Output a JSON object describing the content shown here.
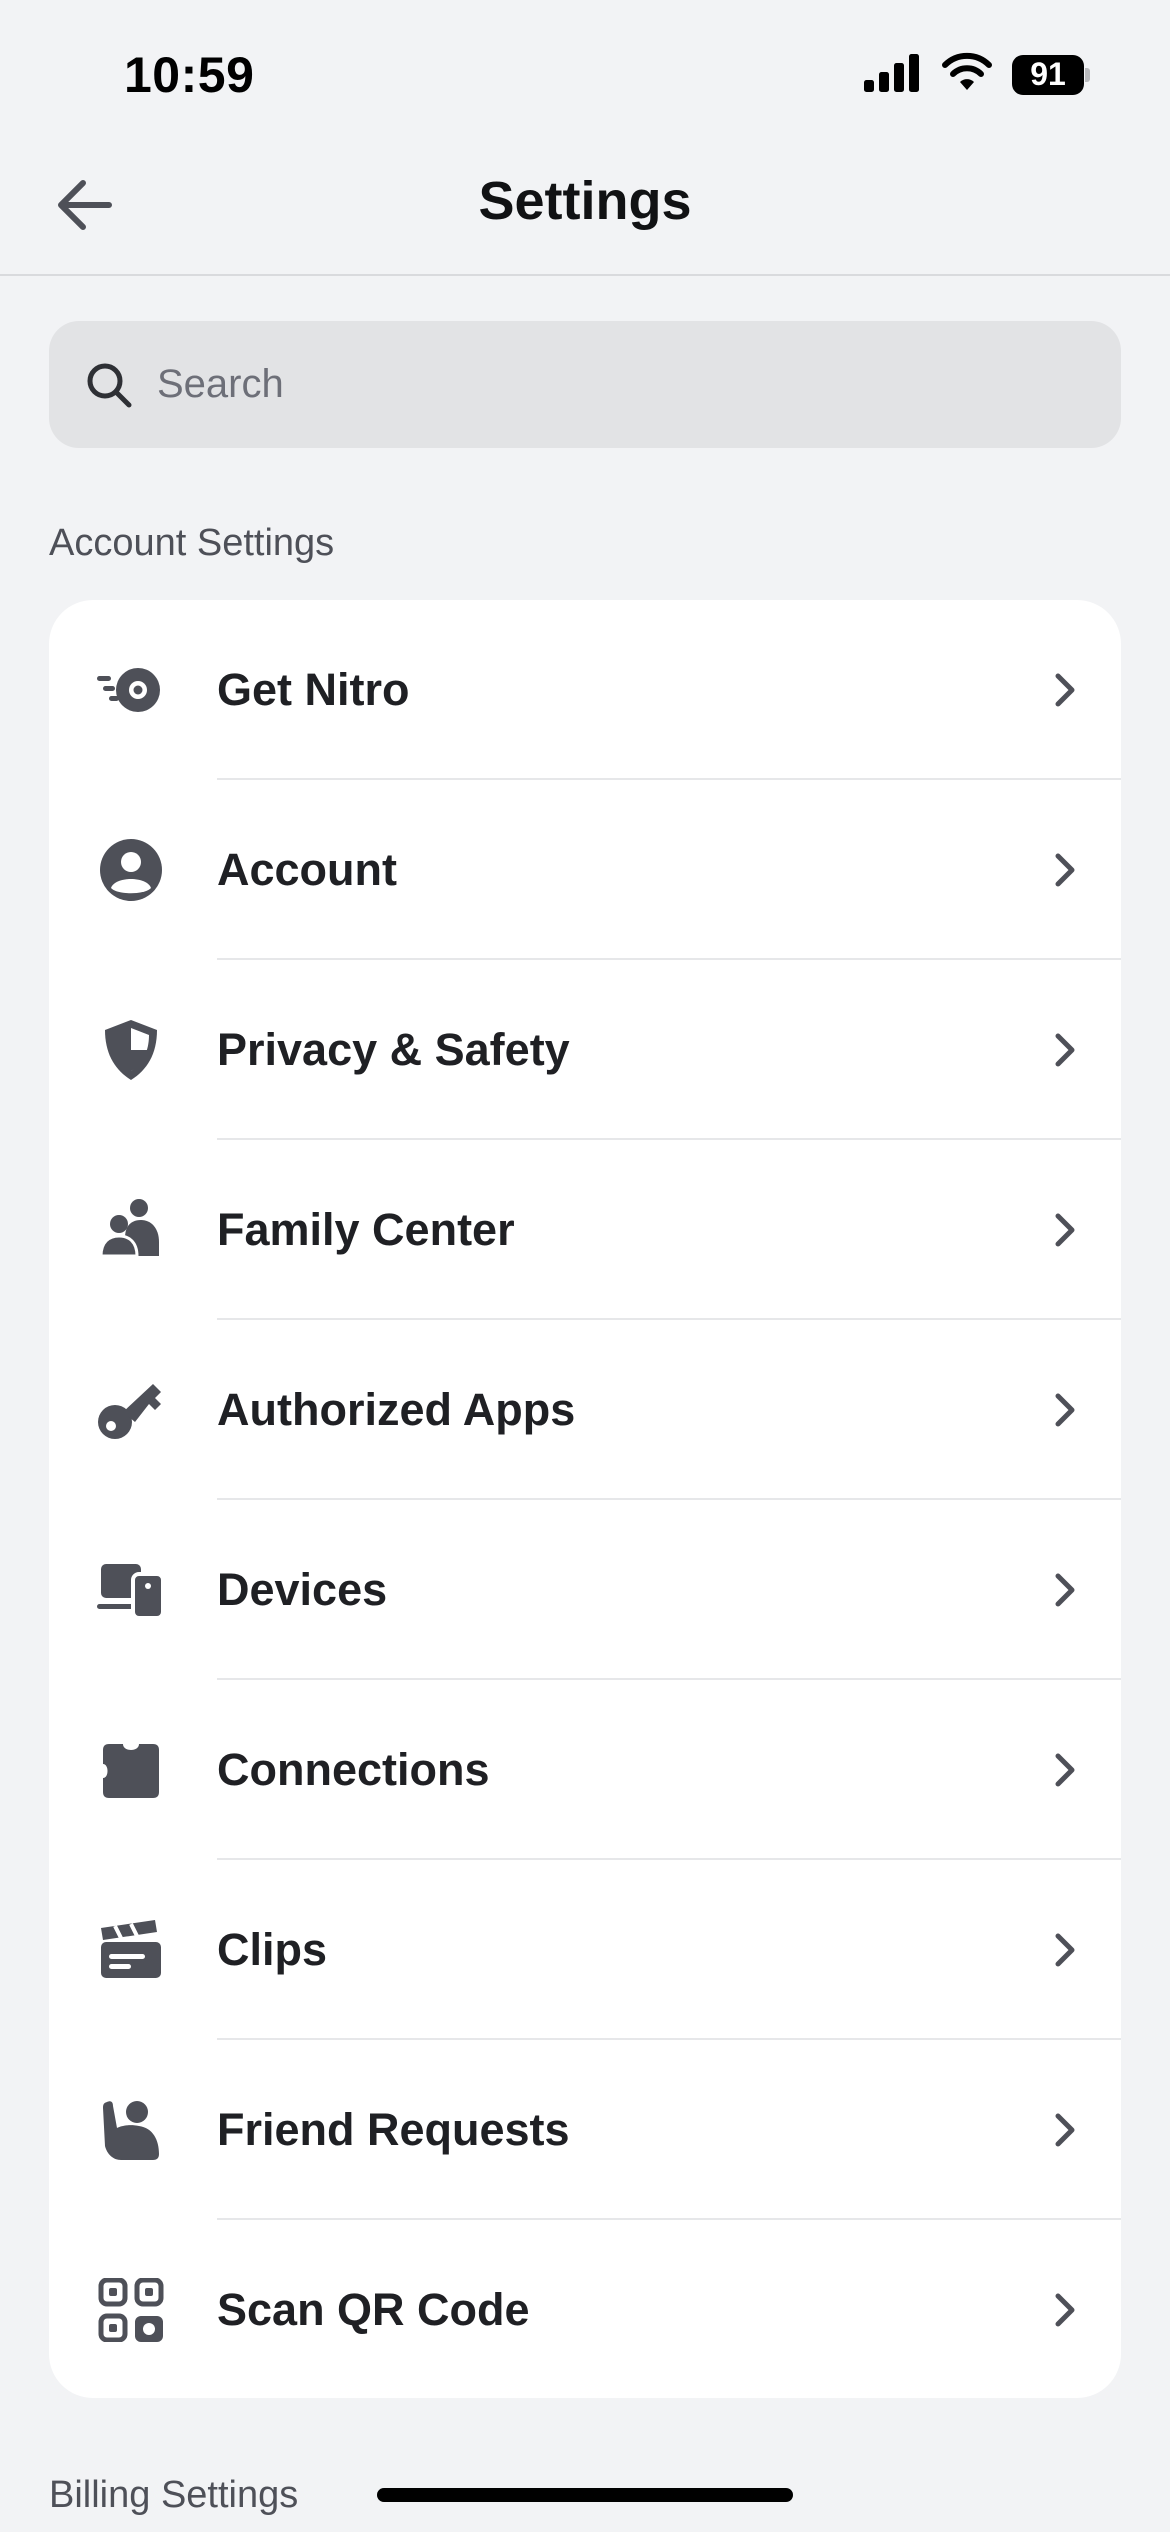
{
  "status_bar": {
    "time": "10:59",
    "battery": "91"
  },
  "nav": {
    "title": "Settings"
  },
  "search": {
    "placeholder": "Search",
    "value": ""
  },
  "sections": {
    "account_header": "Account Settings",
    "billing_header": "Billing Settings"
  },
  "account_items": [
    {
      "label": "Get Nitro",
      "icon": "nitro-icon"
    },
    {
      "label": "Account",
      "icon": "account-icon"
    },
    {
      "label": "Privacy & Safety",
      "icon": "shield-icon"
    },
    {
      "label": "Family Center",
      "icon": "family-icon"
    },
    {
      "label": "Authorized Apps",
      "icon": "key-icon"
    },
    {
      "label": "Devices",
      "icon": "devices-icon"
    },
    {
      "label": "Connections",
      "icon": "puzzle-icon"
    },
    {
      "label": "Clips",
      "icon": "clapper-icon"
    },
    {
      "label": "Friend Requests",
      "icon": "wave-icon"
    },
    {
      "label": "Scan QR Code",
      "icon": "qr-code-icon"
    }
  ],
  "colors": {
    "background": "#f2f3f5",
    "card": "#ffffff",
    "icon": "#4e5058",
    "text": "#1f2024"
  }
}
